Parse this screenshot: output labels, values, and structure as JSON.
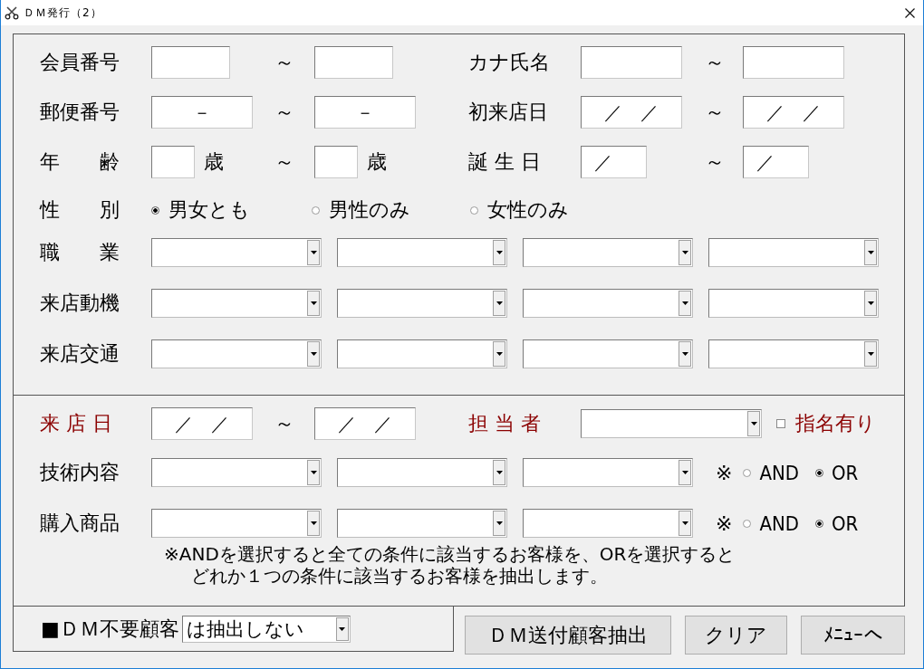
{
  "window": {
    "title": "ＤＭ発行（2）"
  },
  "range_rows": [
    {
      "left": {
        "label": "会員番号",
        "from": {
          "kind": "code"
        },
        "separator": "～",
        "to": {
          "kind": "code"
        }
      },
      "right": {
        "label": "カナ氏名",
        "from": {
          "kind": "name"
        },
        "separator": "～",
        "to": {
          "kind": "name"
        }
      }
    },
    {
      "left": {
        "label": "郵便番号",
        "from": {
          "kind": "postal",
          "value": "－"
        },
        "separator": "～",
        "to": {
          "kind": "postal",
          "value": "－"
        }
      },
      "right": {
        "label": "初来店日",
        "from": {
          "kind": "date",
          "value": "／　／"
        },
        "separator": "～",
        "to": {
          "kind": "date",
          "value": "／　／"
        }
      }
    },
    {
      "left": {
        "label": "年　　齢",
        "from": {
          "kind": "age",
          "unit": "歳"
        },
        "separator": "～",
        "to": {
          "kind": "age",
          "unit": "歳"
        }
      },
      "right": {
        "label": "誕 生 日",
        "from": {
          "kind": "month_day",
          "value": "／"
        },
        "separator": "～",
        "to": {
          "kind": "month_day",
          "value": "／"
        }
      }
    }
  ],
  "gender": {
    "label": "性　　別",
    "options": [
      {
        "label": "男女とも",
        "selected": true
      },
      {
        "label": "男性のみ",
        "selected": false
      },
      {
        "label": "女性のみ",
        "selected": false
      }
    ]
  },
  "select_rows": [
    {
      "label": "職　　業",
      "dropdowns": [
        {
          "kind": "dropdown"
        },
        {
          "kind": "dropdown"
        },
        {
          "kind": "dropdown"
        },
        {
          "kind": "dropdown"
        }
      ]
    },
    {
      "label": "来店動機",
      "dropdowns": [
        {
          "kind": "dropdown"
        },
        {
          "kind": "dropdown"
        },
        {
          "kind": "dropdown"
        },
        {
          "kind": "dropdown"
        }
      ]
    },
    {
      "label": "来店交通",
      "dropdowns": [
        {
          "kind": "dropdown"
        },
        {
          "kind": "dropdown"
        },
        {
          "kind": "dropdown"
        },
        {
          "kind": "dropdown"
        }
      ]
    }
  ],
  "visit": {
    "label": "来 店 日",
    "highlight": true,
    "from": {
      "kind": "date",
      "value": "／　／"
    },
    "separator": "～",
    "to": {
      "kind": "date",
      "value": "／　／"
    }
  },
  "staff": {
    "label": "担 当 者",
    "highlight": true,
    "checkbox": {
      "label": "指名有り",
      "checked": false,
      "highlight": true
    }
  },
  "match_rows": [
    {
      "label": "技術内容",
      "highlight": false,
      "dropdowns": [
        {
          "kind": "dropdown"
        },
        {
          "kind": "dropdown"
        },
        {
          "kind": "dropdown"
        }
      ],
      "mark": "※",
      "options": [
        {
          "label": "AND",
          "selected": false
        },
        {
          "label": "OR",
          "selected": true
        }
      ]
    },
    {
      "label": "購入商品",
      "highlight": false,
      "dropdowns": [
        {
          "kind": "dropdown"
        },
        {
          "kind": "dropdown"
        },
        {
          "kind": "dropdown"
        }
      ],
      "mark": "※",
      "options": [
        {
          "label": "AND",
          "selected": false
        },
        {
          "label": "OR",
          "selected": true
        }
      ]
    }
  ],
  "note": [
    "※ANDを選択すると全ての条件に該当するお客様を、ORを選択すると",
    "どれか１つの条件に該当するお客様を抽出します。"
  ],
  "exclude": {
    "label": "■ＤＭ不要顧客",
    "value": "は抽出しない"
  },
  "buttons": [
    "ＤＭ送付顧客抽出",
    "クリア",
    "ﾒﾆｭｰへ"
  ]
}
